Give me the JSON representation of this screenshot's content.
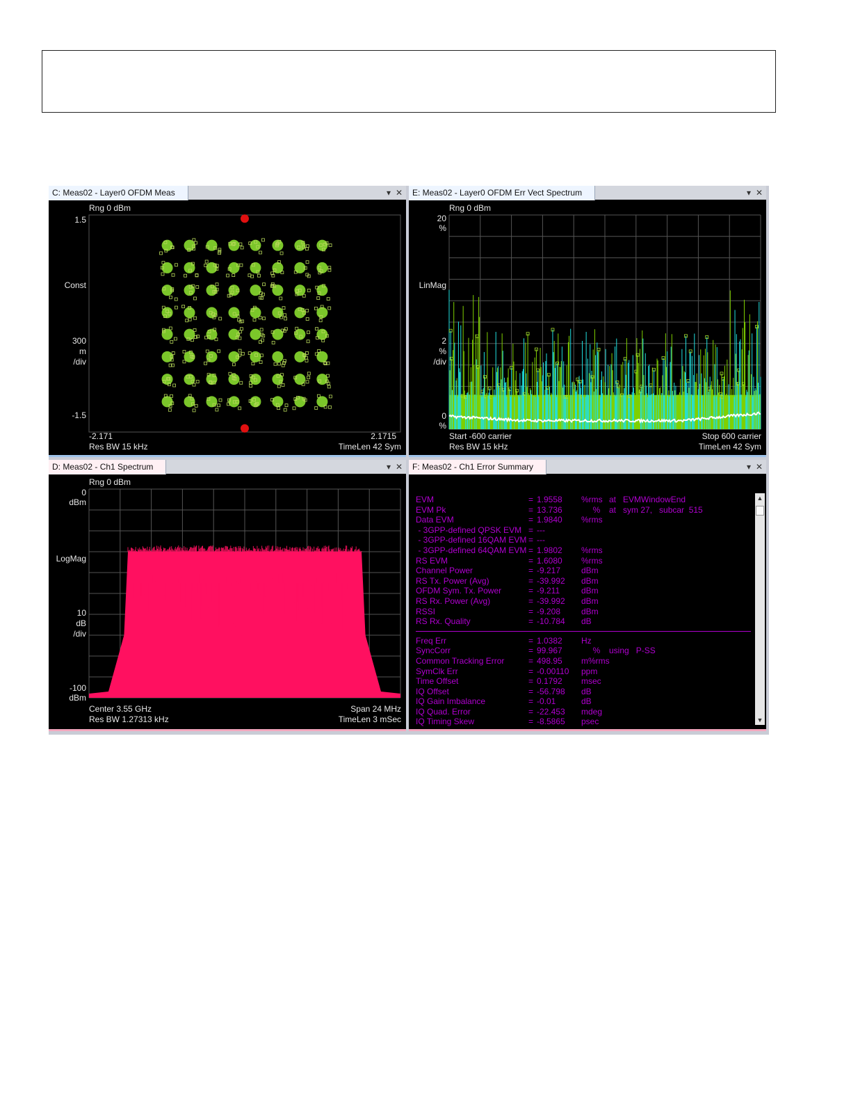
{
  "panes": {
    "C": {
      "title": "C: Meas02 - Layer0 OFDM Meas",
      "rng": "Rng 0 dBm",
      "y_top": "1.5",
      "y_mid": "Const",
      "y_scale": [
        "300",
        "m",
        "/div"
      ],
      "y_bottom": "-1.5",
      "x_left": "-2.171",
      "x_right": "2.1715",
      "footer_left": "Res BW 15 kHz",
      "footer_right": "TimeLen 42  Sym"
    },
    "E": {
      "title": "E: Meas02 - Layer0 OFDM Err Vect Spectrum",
      "rng": "Rng 0 dBm",
      "y_top": [
        "20",
        "%"
      ],
      "y_mid": "LinMag",
      "y_scale": [
        "2",
        "%",
        "/div"
      ],
      "y_bottom": [
        "0",
        "%"
      ],
      "x_left": "Start -600  carrier",
      "x_right": "Stop 600  carrier",
      "footer_left": "Res BW 15 kHz",
      "footer_right": "TimeLen 42  Sym"
    },
    "D": {
      "title": "D: Meas02 - Ch1 Spectrum",
      "rng": "Rng 0 dBm",
      "y_top": [
        "0",
        "dBm"
      ],
      "y_mid": "LogMag",
      "y_scale": [
        "10",
        "dB",
        "/div"
      ],
      "y_bottom": [
        "-100",
        "dBm"
      ],
      "x_left": "Center 3.55 GHz",
      "x_right": "Span 24 MHz",
      "footer_left": "Res BW 1.27313 kHz",
      "footer_right": "TimeLen 3 mSec"
    },
    "F": {
      "title": "F: Meas02 - Ch1 Error Summary",
      "rows_a": [
        {
          "name": "EVM",
          "eq": "=",
          "value": "1.9558",
          "unit": "%rms",
          "extra": "at   EVMWindowEnd"
        },
        {
          "name": "EVM Pk",
          "eq": "=",
          "value": "13.736",
          "unit": "     %",
          "extra": "at   sym 27,   subcar  515"
        },
        {
          "name": "Data EVM",
          "eq": "=",
          "value": "1.9840",
          "unit": "%rms",
          "extra": ""
        },
        {
          "name": " - 3GPP-defined QPSK EVM",
          "eq": "=",
          "value": "---",
          "unit": "",
          "extra": ""
        },
        {
          "name": " - 3GPP-defined 16QAM EVM",
          "eq": "=",
          "value": "---",
          "unit": "",
          "extra": ""
        },
        {
          "name": " - 3GPP-defined 64QAM EVM",
          "eq": "=",
          "value": "1.9802",
          "unit": "%rms",
          "extra": ""
        },
        {
          "name": "RS EVM",
          "eq": "=",
          "value": "1.6080",
          "unit": "%rms",
          "extra": ""
        },
        {
          "name": "Channel Power",
          "eq": "=",
          "value": "-9.217",
          "unit": "dBm",
          "extra": ""
        },
        {
          "name": "RS Tx. Power (Avg)",
          "eq": "=",
          "value": "-39.992",
          "unit": "dBm",
          "extra": ""
        },
        {
          "name": "OFDM Sym. Tx. Power",
          "eq": "=",
          "value": "-9.211",
          "unit": "dBm",
          "extra": ""
        },
        {
          "name": "RS Rx. Power (Avg)",
          "eq": "=",
          "value": "-39.992",
          "unit": "dBm",
          "extra": ""
        },
        {
          "name": "RSSI",
          "eq": "=",
          "value": "-9.208",
          "unit": "dBm",
          "extra": ""
        },
        {
          "name": "RS Rx. Quality",
          "eq": "=",
          "value": "-10.784",
          "unit": "dB",
          "extra": ""
        }
      ],
      "rows_b": [
        {
          "name": "Freq Err",
          "eq": "=",
          "value": "1.0382",
          "unit": "Hz",
          "extra": ""
        },
        {
          "name": "SyncCorr",
          "eq": "=",
          "value": "99.967",
          "unit": "     %",
          "extra": "using   P-SS"
        },
        {
          "name": "Common Tracking Error",
          "eq": "=",
          "value": "498.95",
          "unit": "m%rms",
          "extra": ""
        },
        {
          "name": "SymClk Err",
          "eq": "=",
          "value": "-0.00110",
          "unit": "ppm",
          "extra": ""
        },
        {
          "name": "Time Offset",
          "eq": "=",
          "value": "0.1792",
          "unit": "msec",
          "extra": ""
        },
        {
          "name": "IQ Offset",
          "eq": "=",
          "value": "-56.798",
          "unit": "dB",
          "extra": ""
        },
        {
          "name": "IQ Gain Imbalance",
          "eq": "=",
          "value": "-0.01",
          "unit": "dB",
          "extra": ""
        },
        {
          "name": "IQ Quad. Error",
          "eq": "=",
          "value": "-22.453",
          "unit": "mdeg",
          "extra": ""
        },
        {
          "name": "IQ Timing Skew",
          "eq": "=",
          "value": "-8.5865",
          "unit": "psec",
          "extra": ""
        }
      ]
    }
  },
  "icons": {
    "dropdown": "▾",
    "close": "✕",
    "scroll_up": "▲",
    "scroll_down": "▼"
  },
  "colors": {
    "constellation": "#7bc62a",
    "pilot": "#e01010",
    "evm_green": "#7fd000",
    "evm_cyan": "#20e0e0",
    "evm_avg": "#ffffff",
    "spectrum": "#ff1060",
    "summary_text": "#b000d0",
    "grid": "#555555"
  },
  "chart_data": [
    {
      "type": "scatter",
      "name_ref": "constellation",
      "xlim": [
        -2.171,
        2.1715
      ],
      "ylim": [
        -1.5,
        1.5
      ],
      "series": [
        {
          "values_note_ref": "64QAM 8x8 grid",
          "x": [
            -1.08,
            -0.77,
            -0.46,
            -0.15,
            0.15,
            0.46,
            0.77,
            1.08
          ],
          "y": [
            1.08,
            0.77,
            0.46,
            0.15,
            -0.15,
            -0.46,
            -0.77,
            -1.08
          ]
        },
        {
          "x": [
            0.0,
            0.0
          ],
          "y": [
            1.45,
            -1.45
          ]
        }
      ]
    },
    {
      "type": "line",
      "xlim": [
        -600,
        600
      ],
      "ylim": [
        0,
        20
      ],
      "series": [
        {
          "x": [
            -600,
            -300,
            0,
            300,
            600
          ],
          "y": [
            1.2,
            0.8,
            0.8,
            0.8,
            1.5
          ]
        }
      ]
    },
    {
      "type": "area",
      "xlim": [
        -12,
        12
      ],
      "ylim": [
        -100,
        0
      ],
      "series": [
        {
          "x": [
            -12,
            -10.5,
            -9.3,
            -9,
            0,
            9,
            9.3,
            10.5,
            12
          ],
          "y": [
            -98,
            -97,
            -70,
            -30,
            -30,
            -30,
            -70,
            -97,
            -98
          ]
        }
      ]
    }
  ]
}
